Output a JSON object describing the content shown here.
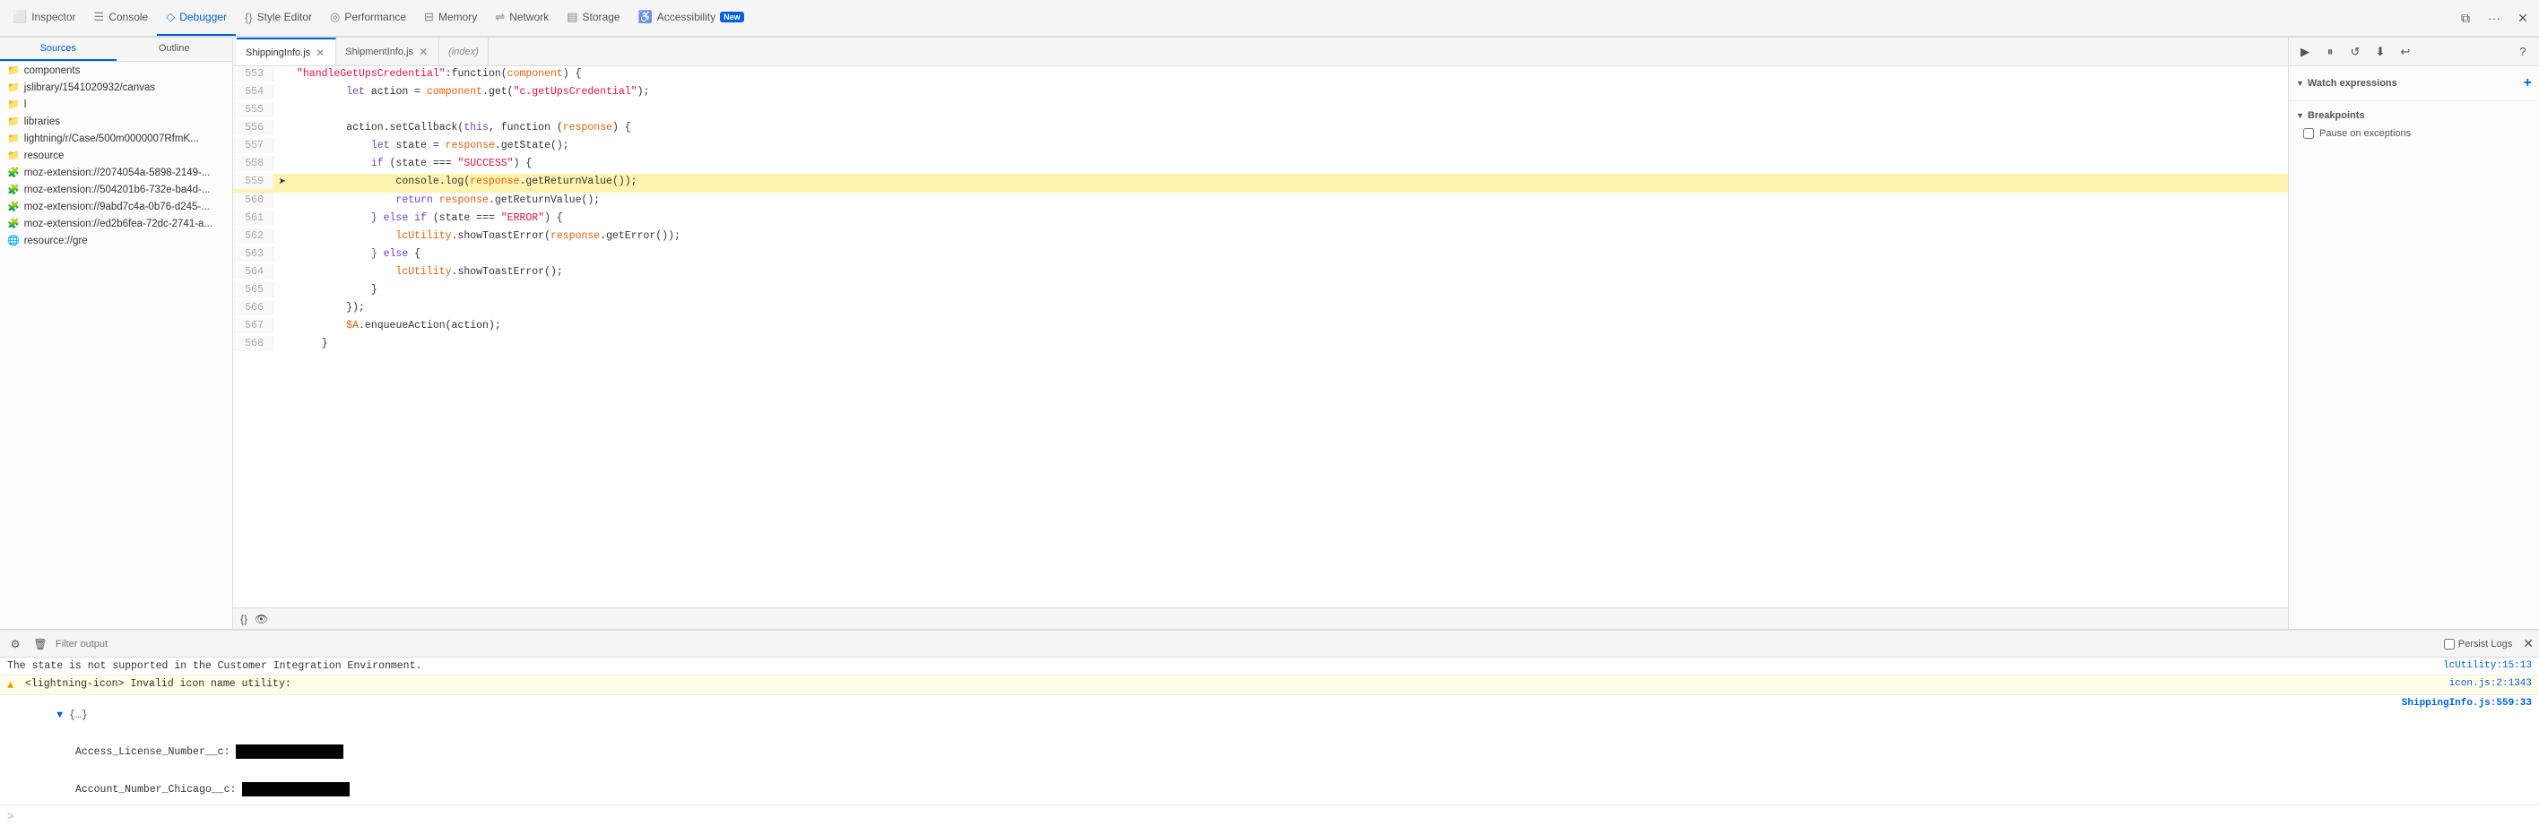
{
  "toolbar": {
    "tabs": [
      {
        "id": "inspector",
        "label": "Inspector",
        "icon": "⬜",
        "active": false
      },
      {
        "id": "console",
        "label": "Console",
        "icon": "☰",
        "active": false
      },
      {
        "id": "debugger",
        "label": "Debugger",
        "icon": "◇",
        "active": true
      },
      {
        "id": "style-editor",
        "label": "Style Editor",
        "icon": "{}",
        "active": false
      },
      {
        "id": "performance",
        "label": "Performance",
        "icon": "◎",
        "active": false
      },
      {
        "id": "memory",
        "label": "Memory",
        "icon": "⊟",
        "active": false
      },
      {
        "id": "network",
        "label": "Network",
        "icon": "⇌",
        "active": false
      },
      {
        "id": "storage",
        "label": "Storage",
        "icon": "▤",
        "active": false
      },
      {
        "id": "accessibility",
        "label": "Accessibility",
        "icon": "♿",
        "active": false,
        "badge": "New"
      }
    ],
    "right_icons": [
      "responsive",
      "overflow",
      "close"
    ]
  },
  "sidebar": {
    "tabs": [
      "Sources",
      "Outline"
    ],
    "active_tab": "Sources",
    "items": [
      {
        "type": "folder",
        "label": "components"
      },
      {
        "type": "folder",
        "label": "jslibrary/1541020932/canvas"
      },
      {
        "type": "folder",
        "label": "l"
      },
      {
        "type": "folder",
        "label": "libraries"
      },
      {
        "type": "folder",
        "label": "lightning/r/Case/500m0000007RfmK..."
      },
      {
        "type": "folder",
        "label": "resource"
      },
      {
        "type": "extension",
        "label": "moz-extension://2074054a-5898-2149-..."
      },
      {
        "type": "extension",
        "label": "moz-extension://504201b6-732e-ba4d-..."
      },
      {
        "type": "extension",
        "label": "moz-extension://9abd7c4a-0b76-d245-..."
      },
      {
        "type": "extension",
        "label": "moz-extension://ed2b6fea-72dc-2741-a..."
      },
      {
        "type": "globe",
        "label": "resource://gre"
      }
    ]
  },
  "editor": {
    "tabs": [
      {
        "id": "shipping",
        "label": "ShippingInfo.js",
        "closeable": true,
        "active": true
      },
      {
        "id": "shipment",
        "label": "ShipmentInfo.js",
        "closeable": true,
        "active": false
      },
      {
        "id": "index",
        "label": "(index)",
        "closeable": false,
        "active": false
      }
    ],
    "lines": [
      {
        "num": 553,
        "arrow": false,
        "content": "    \"handleGetUpsCredential\":function(component) {",
        "tokens": [
          {
            "text": "    ",
            "class": ""
          },
          {
            "text": "\"handleGetUpsCredential\"",
            "class": "str"
          },
          {
            "text": ":function(",
            "class": ""
          },
          {
            "text": "component",
            "class": "var-name"
          },
          {
            "text": ") {",
            "class": ""
          }
        ]
      },
      {
        "num": 554,
        "arrow": false,
        "content": "        let action = component.get(\"c.getUpsCredential\");",
        "tokens": [
          {
            "text": "        ",
            "class": ""
          },
          {
            "text": "let",
            "class": "kw"
          },
          {
            "text": " action = ",
            "class": ""
          },
          {
            "text": "component",
            "class": "var-name"
          },
          {
            "text": ".get(",
            "class": ""
          },
          {
            "text": "\"c.getUpsCredential\"",
            "class": "str"
          },
          {
            "text": ");",
            "class": ""
          }
        ]
      },
      {
        "num": 555,
        "arrow": false,
        "content": "",
        "tokens": []
      },
      {
        "num": 556,
        "arrow": false,
        "content": "        action.setCallback(this, function (response) {",
        "tokens": [
          {
            "text": "        ",
            "class": ""
          },
          {
            "text": "action",
            "class": ""
          },
          {
            "text": ".setCallback(",
            "class": ""
          },
          {
            "text": "this",
            "class": "kw"
          },
          {
            "text": ", function (",
            "class": ""
          },
          {
            "text": "response",
            "class": "var-name"
          },
          {
            "text": ") {",
            "class": ""
          }
        ]
      },
      {
        "num": 557,
        "arrow": false,
        "content": "            let state = response.getState();",
        "tokens": [
          {
            "text": "            ",
            "class": ""
          },
          {
            "text": "let",
            "class": "kw"
          },
          {
            "text": " state = ",
            "class": ""
          },
          {
            "text": "response",
            "class": "var-name"
          },
          {
            "text": ".getState();",
            "class": ""
          }
        ]
      },
      {
        "num": 558,
        "arrow": false,
        "content": "            if (state === \"SUCCESS\") {",
        "tokens": [
          {
            "text": "            ",
            "class": ""
          },
          {
            "text": "if",
            "class": "kw"
          },
          {
            "text": " (state === ",
            "class": ""
          },
          {
            "text": "\"SUCCESS\"",
            "class": "str"
          },
          {
            "text": ") {",
            "class": ""
          }
        ]
      },
      {
        "num": 559,
        "arrow": true,
        "content": "                console.log(response.getReturnValue());",
        "tokens": [
          {
            "text": "                ",
            "class": ""
          },
          {
            "text": "console",
            "class": ""
          },
          {
            "text": ".log(",
            "class": ""
          },
          {
            "text": "response",
            "class": "var-name"
          },
          {
            "text": ".getReturnValue());",
            "class": ""
          }
        ]
      },
      {
        "num": 560,
        "arrow": false,
        "content": "                return response.getReturnValue();",
        "tokens": [
          {
            "text": "                ",
            "class": ""
          },
          {
            "text": "return",
            "class": "kw"
          },
          {
            "text": " response",
            "class": "var-name"
          },
          {
            "text": ".getReturnValue();",
            "class": ""
          }
        ]
      },
      {
        "num": 561,
        "arrow": false,
        "content": "            } else if (state === \"ERROR\") {",
        "tokens": [
          {
            "text": "            ",
            "class": ""
          },
          {
            "text": "} else if",
            "class": "kw"
          },
          {
            "text": " (state === ",
            "class": ""
          },
          {
            "text": "\"ERROR\"",
            "class": "str"
          },
          {
            "text": ") {",
            "class": ""
          }
        ]
      },
      {
        "num": 562,
        "arrow": false,
        "content": "                lcUtility.showToastError(response.getError());",
        "tokens": [
          {
            "text": "                ",
            "class": ""
          },
          {
            "text": "lcUtility",
            "class": "var-name"
          },
          {
            "text": ".showToastError(",
            "class": ""
          },
          {
            "text": "response",
            "class": "var-name"
          },
          {
            "text": ".getError());",
            "class": ""
          }
        ]
      },
      {
        "num": 563,
        "arrow": false,
        "content": "            } else {",
        "tokens": [
          {
            "text": "            ",
            "class": ""
          },
          {
            "text": "} else",
            "class": "kw"
          },
          {
            "text": " {",
            "class": ""
          }
        ]
      },
      {
        "num": 564,
        "arrow": false,
        "content": "                lcUtility.showToastError();",
        "tokens": [
          {
            "text": "                ",
            "class": ""
          },
          {
            "text": "lcUtility",
            "class": "var-name"
          },
          {
            "text": ".showToastError();",
            "class": ""
          }
        ]
      },
      {
        "num": 565,
        "arrow": false,
        "content": "            }",
        "tokens": [
          {
            "text": "            }",
            "class": ""
          }
        ]
      },
      {
        "num": 566,
        "arrow": false,
        "content": "        });",
        "tokens": [
          {
            "text": "        });",
            "class": ""
          }
        ]
      },
      {
        "num": 567,
        "arrow": false,
        "content": "        $A.enqueueAction(action);",
        "tokens": [
          {
            "text": "        ",
            "class": ""
          },
          {
            "text": "$A",
            "class": "var-name"
          },
          {
            "text": ".enqueueAction(action);",
            "class": ""
          }
        ]
      },
      {
        "num": 568,
        "arrow": false,
        "content": "    }",
        "tokens": [
          {
            "text": "    }",
            "class": ""
          }
        ]
      }
    ],
    "bottom_bar": {
      "left_icon": "{}",
      "right_icon": "👁"
    }
  },
  "right_panel": {
    "toolbar_icons": [
      "▶",
      "⏸",
      "↺",
      "⬇",
      "↩"
    ],
    "watch_expressions": {
      "title": "Watch expressions",
      "expanded": true,
      "add_label": "+"
    },
    "breakpoints": {
      "title": "Breakpoints",
      "expanded": true,
      "pause_on_exceptions": "Pause on exceptions"
    }
  },
  "console": {
    "filter_placeholder": "Filter output",
    "persist_logs": "Persist Logs",
    "lines": [
      {
        "type": "info",
        "icon": "",
        "content": "The state is not supported in the Customer Integration Environment.",
        "source": "lcUtility:15:13"
      },
      {
        "type": "warning",
        "icon": "▲",
        "content": "<lightning-icon> Invalid icon name utility:",
        "source": "icon.js:2:1343"
      },
      {
        "type": "info",
        "icon": "",
        "content": "▼ {…}",
        "source": "ShippingInfo.js:559:33",
        "source_blue": true,
        "obj_expanded": true,
        "sub_items": [
          {
            "key": "Access_License_Number__c:",
            "value": "REDACTED"
          },
          {
            "key": "Account_Number_Chicago__c:",
            "value": "REDACTED"
          }
        ]
      }
    ],
    "bottom_cursor": ">"
  }
}
